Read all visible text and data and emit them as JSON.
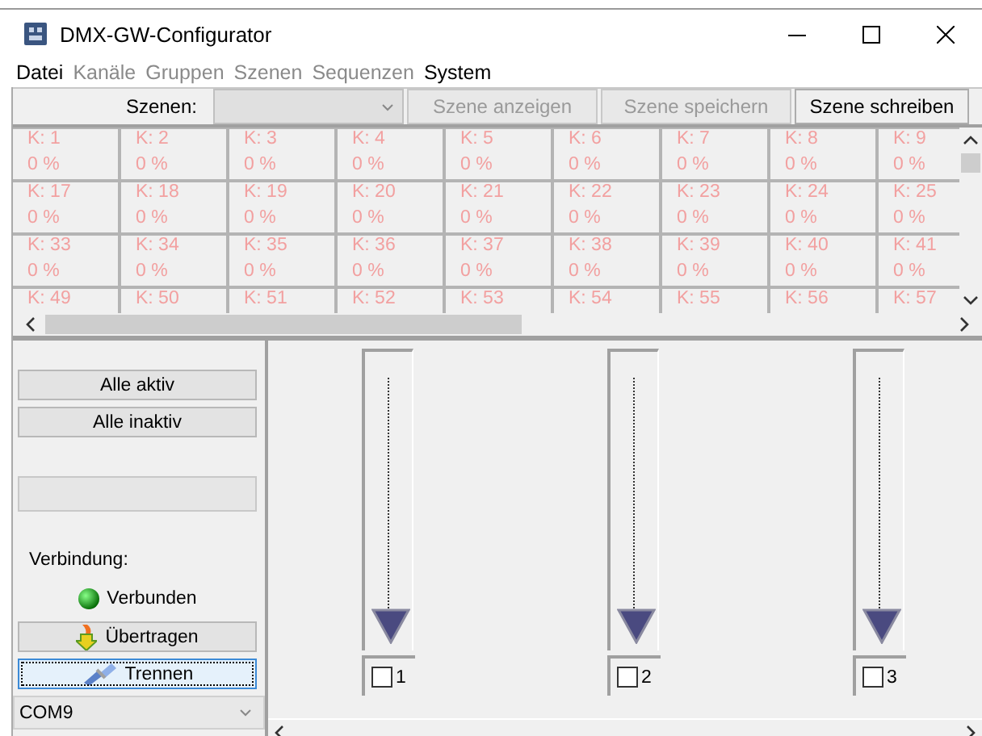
{
  "window": {
    "title": "DMX-GW-Configurator"
  },
  "menu": [
    {
      "label": "Datei",
      "disabled": false
    },
    {
      "label": "Kanäle",
      "disabled": true
    },
    {
      "label": "Gruppen",
      "disabled": true
    },
    {
      "label": "Szenen",
      "disabled": true
    },
    {
      "label": "Sequenzen",
      "disabled": true
    },
    {
      "label": "System",
      "disabled": false
    }
  ],
  "scene_bar": {
    "label": "Szenen:",
    "combo_disabled": true,
    "buttons": [
      {
        "label": "Szene anzeigen",
        "disabled": true
      },
      {
        "label": "Szene speichern",
        "disabled": true
      },
      {
        "label": "Szene schreiben",
        "disabled": false
      }
    ]
  },
  "channels": [
    {
      "label": "K: 1",
      "value": "0 %",
      "active": false
    },
    {
      "label": "K: 2",
      "value": "0 %",
      "active": false
    },
    {
      "label": "K: 3",
      "value": "0 %",
      "active": false
    },
    {
      "label": "K: 4",
      "value": "0 %",
      "active": false
    },
    {
      "label": "K: 5",
      "value": "0 %",
      "active": false
    },
    {
      "label": "K: 6",
      "value": "0 %",
      "active": false
    },
    {
      "label": "K: 7",
      "value": "0 %",
      "active": false
    },
    {
      "label": "K: 8",
      "value": "0 %",
      "active": false
    },
    {
      "label": "K: 9",
      "value": "0 %",
      "active": false
    },
    {
      "label": "K: 17",
      "value": "0 %",
      "active": false
    },
    {
      "label": "K: 18",
      "value": "0 %",
      "active": false
    },
    {
      "label": "K: 19",
      "value": "0 %",
      "active": false
    },
    {
      "label": "K: 20",
      "value": "0 %",
      "active": false
    },
    {
      "label": "K: 21",
      "value": "0 %",
      "active": false
    },
    {
      "label": "K: 22",
      "value": "0 %",
      "active": false
    },
    {
      "label": "K: 23",
      "value": "0 %",
      "active": false
    },
    {
      "label": "K: 24",
      "value": "0 %",
      "active": false
    },
    {
      "label": "K: 25",
      "value": "0 %",
      "active": false
    },
    {
      "label": "K: 33",
      "value": "0 %",
      "active": false
    },
    {
      "label": "K: 34",
      "value": "0 %",
      "active": false
    },
    {
      "label": "K: 35",
      "value": "0 %",
      "active": false
    },
    {
      "label": "K: 36",
      "value": "0 %",
      "active": false
    },
    {
      "label": "K: 37",
      "value": "0 %",
      "active": false
    },
    {
      "label": "K: 38",
      "value": "0 %",
      "active": false
    },
    {
      "label": "K: 39",
      "value": "0 %",
      "active": false
    },
    {
      "label": "K: 40",
      "value": "0 %",
      "active": false
    },
    {
      "label": "K: 41",
      "value": "0 %",
      "active": false
    },
    {
      "label": "K: 49",
      "active": false
    },
    {
      "label": "K: 50",
      "active": false
    },
    {
      "label": "K: 51",
      "active": false
    },
    {
      "label": "K: 52",
      "active": false
    },
    {
      "label": "K: 53",
      "active": false
    },
    {
      "label": "K: 54",
      "active": false
    },
    {
      "label": "K: 55",
      "active": false
    },
    {
      "label": "K: 56",
      "active": false
    },
    {
      "label": "K: 57",
      "active": false
    }
  ],
  "left_panel": {
    "buttons": [
      {
        "label": "Alle aktiv"
      },
      {
        "label": "Alle inaktiv"
      }
    ],
    "connection_label": "Verbindung:",
    "status": {
      "label": "Verbunden",
      "connected": true
    },
    "actions": [
      {
        "label": "Übertragen",
        "kind": "transfer",
        "focused": false
      },
      {
        "label": "Trennen",
        "kind": "disconnect",
        "focused": true
      }
    ],
    "port": {
      "value": "COM9"
    }
  },
  "faders": [
    {
      "label": "1",
      "level": 0,
      "checked": false
    },
    {
      "label": "2",
      "level": 0,
      "checked": false
    },
    {
      "label": "3",
      "level": 0,
      "checked": false
    }
  ]
}
